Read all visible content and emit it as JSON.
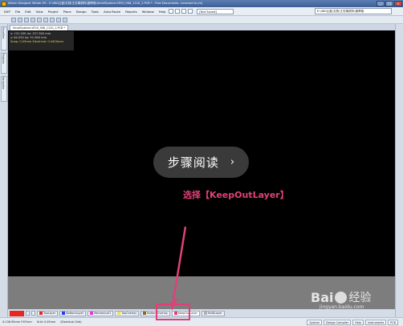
{
  "window": {
    "title": "Altium Designer Winter 09 - E:\\360云盘\\文档\\王志娟资料\\报摩卷\\SmallSystem-VEV0_908_1120_1.PCB * - Free Documents. Licensed to jmj",
    "controls": [
      "_",
      "□",
      "×"
    ]
  },
  "menubar": {
    "items": [
      "DXP",
      "File",
      "Edit",
      "View",
      "Project",
      "Place",
      "Design",
      "Tools",
      "Auto Route",
      "Reports",
      "Window",
      "Help"
    ],
    "combo_value": "[Not Saved]",
    "path_value": "E:\\360云盘\\文档\\王志娟资料\\报摩卷"
  },
  "left_panel": {
    "tabs": [
      "Favorites",
      "Projects",
      "Navigator"
    ]
  },
  "document": {
    "tab_label": "SmallSystem-VEV0_908_1120_1.PCB *"
  },
  "coord_readout": {
    "line1": "x: 131.200    dx: 157.300 mm",
    "line2": "y: 64.550     dy: 51.560 mm",
    "line3": "Snap: 0.05mm Electrical: 0.0400mm"
  },
  "layers": {
    "tabs": [
      {
        "label": "TopLayer",
        "color": "#e6261f"
      },
      {
        "label": "BottomLayer",
        "color": "#1e3ee6"
      },
      {
        "label": "Mechanical1",
        "color": "#e03cd6"
      },
      {
        "label": "TopOverlay",
        "color": "#f0e040"
      },
      {
        "label": "BottomOverlay",
        "color": "#8a6a20"
      },
      {
        "label": "KeepOutLayer",
        "color": "#e0407a"
      },
      {
        "label": "MultiLayer",
        "color": "#b0b0b0"
      }
    ],
    "active_tab": "KeepOutLayer",
    "current_layer_color": "#e6261f"
  },
  "statusbar": {
    "coords": "X:136.95mm Y:97mm",
    "grid": "Grid: 0.05mm",
    "mode": "(Electrical Grid)",
    "panels": [
      "System",
      "Design Compiler",
      "Help",
      "Instruments",
      "PCB"
    ]
  },
  "overlay": {
    "read_button": "步骤阅读",
    "read_arrow": "›",
    "caption": "选择【KeepOutLayer】",
    "accent_color": "#e0407a"
  },
  "watermark": {
    "brand": "Bai",
    "brand_suffix": "经验",
    "url": "jingyan.baidu.com"
  }
}
